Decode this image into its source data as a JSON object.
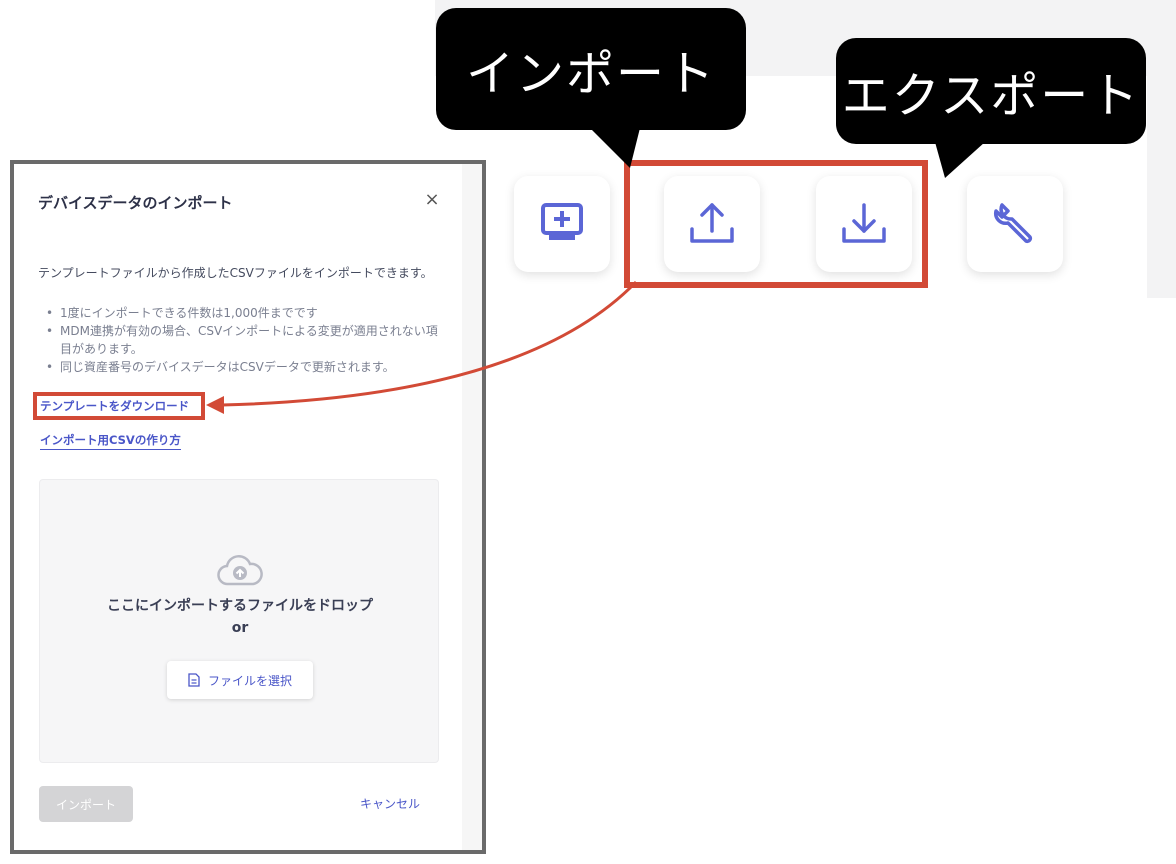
{
  "callouts": {
    "import_label": "インポート",
    "export_label": "エクスポート"
  },
  "toolbar": {
    "buttons": [
      {
        "name": "add-device",
        "icon": "monitor-plus-icon"
      },
      {
        "name": "import",
        "icon": "upload-icon"
      },
      {
        "name": "export",
        "icon": "download-icon"
      },
      {
        "name": "settings",
        "icon": "wrench-icon"
      }
    ]
  },
  "dialog": {
    "title": "デバイスデータのインポート",
    "close_label": "×",
    "description": "テンプレートファイルから作成したCSVファイルをインポートできます。",
    "bullets": [
      "1度にインポートできる件数は1,000件までです",
      "MDM連携が有効の場合、CSVインポートによる変更が適用されない項目があります。",
      "同じ資産番号のデバイスデータはCSVデータで更新されます。"
    ],
    "template_link": "テンプレートをダウンロード",
    "howto_link": "インポート用CSVの作り方",
    "dropzone": {
      "text": "ここにインポートするファイルをドロップ",
      "or": "or",
      "select_button": "ファイルを選択"
    },
    "import_button": "インポート",
    "cancel_button": "キャンセル"
  },
  "colors": {
    "accent": "#4a56c8",
    "highlight": "#d24a36",
    "icon": "#5b66d6"
  }
}
